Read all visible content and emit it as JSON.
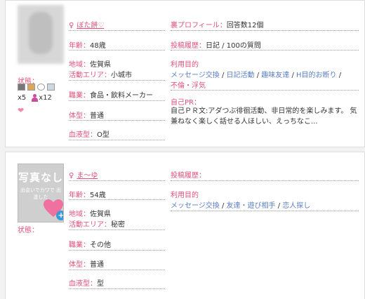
{
  "profiles": [
    {
      "name": "ぼた餅♡",
      "sex_icon": "♀",
      "status_label": "状態：",
      "counts": {
        "photo_count": "x5",
        "friend_count": "x12"
      },
      "fields": [
        {
          "label": "年齢：",
          "value": "48歳"
        },
        {
          "label": "地域：",
          "value": "佐賀県"
        },
        {
          "label": "活動エリア：",
          "value": "小城市"
        },
        {
          "label": "職業：",
          "value": "食品・飲料メーカー"
        },
        {
          "label": "体型：",
          "value": "普通"
        },
        {
          "label": "血液型：",
          "value": "O型"
        }
      ],
      "ura_label": "裏プロフィール：",
      "ura_value": "回答数12個",
      "posts_label": "投稿履歴：",
      "posts_value": "日記 / 100の質問",
      "purpose_label": "利用目的",
      "purposes_line1": [
        "メッセージ交換",
        "日記活動",
        "趣味友達",
        "H目的お断り"
      ],
      "purposes_line2": [
        "不倫・浮気"
      ],
      "pr_label": "自己PR：",
      "pr_text": "自己ＰＲ文:アダつぶ徘徊活動、非日常的を楽しみます。 気兼ねなく楽しく話せる人ほしい、えっちなこ..."
    },
    {
      "name": "ま〜ゆ",
      "sex_icon": "♀",
      "status_label": "状態：",
      "nophoto_big": "写真なし",
      "nophoto_small": "出会いでカワで 出逢した",
      "fields": [
        {
          "label": "年齢：",
          "value": "54歳"
        },
        {
          "label": "地域：",
          "value": "佐賀県"
        },
        {
          "label": "活動エリア：",
          "value": "秘密"
        },
        {
          "label": "職業：",
          "value": "その他"
        },
        {
          "label": "体型：",
          "value": "普通"
        },
        {
          "label": "血液型：",
          "value": "型"
        }
      ],
      "posts_label": "投稿履歴：",
      "purpose_label": "利用目的",
      "purposes_line1": [
        "メッセージ交換",
        "友達・遊び相手",
        "恋人探し"
      ]
    }
  ],
  "icons": {
    "photo": "camera-icon",
    "diary": "diary-icon",
    "chat": "chat-icon",
    "multi": "window-icon",
    "person": "person-icon",
    "heart": "heart-icon"
  },
  "colors": {
    "accent_pink": "#e0507a",
    "link_blue": "#5a7fc4",
    "heart_pink": "#f08aa8"
  }
}
